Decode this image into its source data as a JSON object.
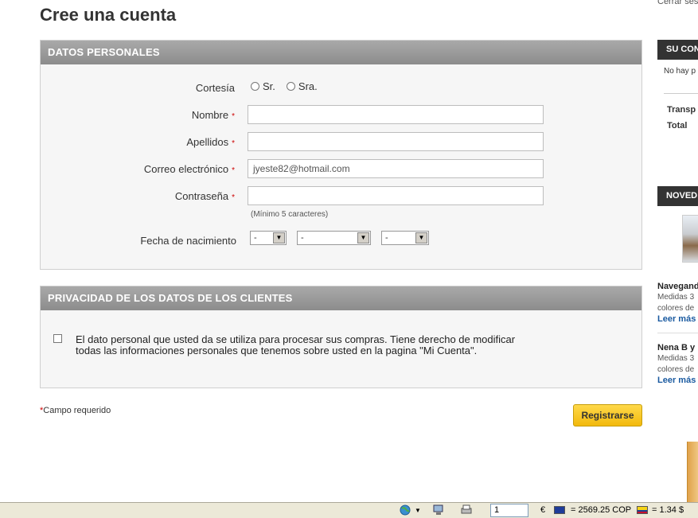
{
  "page_title": "Cree una cuenta",
  "logout_link": "Cerrar ses",
  "personal": {
    "header": "DATOS PERSONALES",
    "courtesy_label": "Cortesía",
    "courtesy_options": [
      "Sr.",
      "Sra."
    ],
    "name_label": "Nombre",
    "surname_label": "Apellidos",
    "email_label": "Correo electrónico",
    "email_value": "jyeste82@hotmail.com",
    "password_label": "Contraseña",
    "password_hint": "(Mínimo 5 caracteres)",
    "birth_label": "Fecha de nacimiento",
    "birth_day": "-",
    "birth_month": "-",
    "birth_year": "-",
    "required_mark": "*"
  },
  "privacy": {
    "header": "PRIVACIDAD DE LOS DATOS DE LOS CLIENTES",
    "text": "El dato personal que usted da se utiliza para procesar sus compras. Tiene derecho de modificar todas las informaciones personales que tenemos sobre usted en la pagina \"Mi Cuenta\"."
  },
  "footer": {
    "required_star": "*",
    "required_note": "Campo requerido",
    "submit_label": "Registrarse"
  },
  "sidebar": {
    "cart_header": "SU CON",
    "cart_empty": "No hay p",
    "shipping_label": "Transp",
    "total_label": "Total",
    "news_header": "NOVED",
    "products": [
      {
        "title": "Navegand",
        "desc1": "Medidas 3",
        "desc2": "colores de",
        "more": "Leer más"
      },
      {
        "title": "Nena B y",
        "desc1": "Medidas 3",
        "desc2": "colores de",
        "more": "Leer más"
      }
    ]
  },
  "statusbar": {
    "page_value": "1",
    "euro_symbol": "€",
    "euro_rate": "= 2569.25 COP",
    "usd_rate": "= 1.34 $"
  }
}
